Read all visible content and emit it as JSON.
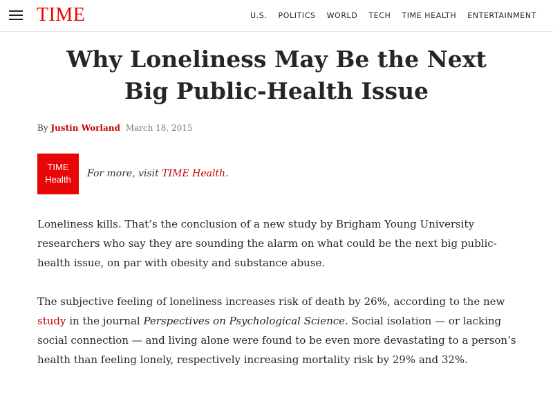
{
  "header": {
    "logo": "TIME",
    "nav": [
      "U.S.",
      "POLITICS",
      "WORLD",
      "TECH",
      "TIME HEALTH",
      "ENTERTAINMENT"
    ]
  },
  "article": {
    "headline_line1": "Why Loneliness May Be the Next",
    "headline_line2": "Big Public-Health Issue",
    "by": "By",
    "author": "Justin Worland",
    "date": "March 18, 2015",
    "badge_line1": "TIME",
    "badge_line2": "Health",
    "promo_prefix": "For more, visit ",
    "promo_link": "TIME Health",
    "promo_suffix": ".",
    "p1": "Loneliness kills. That’s the conclusion of a new study by Brigham Young University researchers who say they are sounding the alarm on what could be the next big public-health issue, on par with obesity and substance abuse.",
    "p2_a": "The subjective feeling of loneliness increases risk of death by 26%, according to the new ",
    "p2_link": "study",
    "p2_b": " in the journal ",
    "p2_journal": "Perspectives on Psychological Science",
    "p2_c": ". Social isolation — or lacking social connection — and living alone were found to be even more devastating to a person’s health than feeling lonely, respectively increasing mortality risk by 29% and 32%."
  },
  "colors": {
    "brand_red": "#e90606",
    "link_red": "#c50000"
  }
}
